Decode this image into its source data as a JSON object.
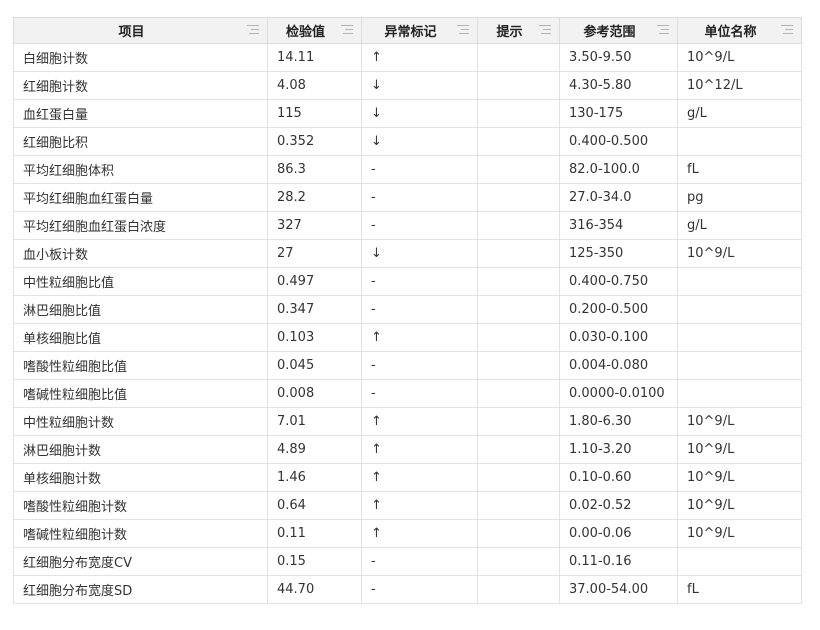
{
  "columns": [
    "项目",
    "检验值",
    "异常标记",
    "提示",
    "参考范围",
    "单位名称"
  ],
  "rows": [
    {
      "item": "白细胞计数",
      "value": "14.11",
      "flag": "↑",
      "hint": "",
      "range": "3.50-9.50",
      "unit": "10^9/L"
    },
    {
      "item": "红细胞计数",
      "value": "4.08",
      "flag": "↓",
      "hint": "",
      "range": "4.30-5.80",
      "unit": "10^12/L"
    },
    {
      "item": "血红蛋白量",
      "value": "115",
      "flag": "↓",
      "hint": "",
      "range": "130-175",
      "unit": "g/L"
    },
    {
      "item": "红细胞比积",
      "value": "0.352",
      "flag": "↓",
      "hint": "",
      "range": "0.400-0.500",
      "unit": ""
    },
    {
      "item": "平均红细胞体积",
      "value": "86.3",
      "flag": "-",
      "hint": "",
      "range": "82.0-100.0",
      "unit": "fL"
    },
    {
      "item": "平均红细胞血红蛋白量",
      "value": "28.2",
      "flag": "-",
      "hint": "",
      "range": "27.0-34.0",
      "unit": "pg"
    },
    {
      "item": "平均红细胞血红蛋白浓度",
      "value": "327",
      "flag": "-",
      "hint": "",
      "range": "316-354",
      "unit": "g/L"
    },
    {
      "item": "血小板计数",
      "value": "27",
      "flag": "↓",
      "hint": "",
      "range": "125-350",
      "unit": "10^9/L"
    },
    {
      "item": "中性粒细胞比值",
      "value": "0.497",
      "flag": "-",
      "hint": "",
      "range": "0.400-0.750",
      "unit": ""
    },
    {
      "item": "淋巴细胞比值",
      "value": "0.347",
      "flag": "-",
      "hint": "",
      "range": "0.200-0.500",
      "unit": ""
    },
    {
      "item": "单核细胞比值",
      "value": "0.103",
      "flag": "↑",
      "hint": "",
      "range": "0.030-0.100",
      "unit": ""
    },
    {
      "item": "嗜酸性粒细胞比值",
      "value": "0.045",
      "flag": "-",
      "hint": "",
      "range": "0.004-0.080",
      "unit": ""
    },
    {
      "item": "嗜碱性粒细胞比值",
      "value": "0.008",
      "flag": "-",
      "hint": "",
      "range": "0.0000-0.0100",
      "unit": ""
    },
    {
      "item": "中性粒细胞计数",
      "value": "7.01",
      "flag": "↑",
      "hint": "",
      "range": "1.80-6.30",
      "unit": "10^9/L"
    },
    {
      "item": "淋巴细胞计数",
      "value": "4.89",
      "flag": "↑",
      "hint": "",
      "range": "1.10-3.20",
      "unit": "10^9/L"
    },
    {
      "item": "单核细胞计数",
      "value": "1.46",
      "flag": "↑",
      "hint": "",
      "range": "0.10-0.60",
      "unit": "10^9/L"
    },
    {
      "item": "嗜酸性粒细胞计数",
      "value": "0.64",
      "flag": "↑",
      "hint": "",
      "range": "0.02-0.52",
      "unit": "10^9/L"
    },
    {
      "item": "嗜碱性粒细胞计数",
      "value": "0.11",
      "flag": "↑",
      "hint": "",
      "range": "0.00-0.06",
      "unit": "10^9/L"
    },
    {
      "item": "红细胞分布宽度CV",
      "value": "0.15",
      "flag": "-",
      "hint": "",
      "range": "0.11-0.16",
      "unit": ""
    },
    {
      "item": "红细胞分布宽度SD",
      "value": "44.70",
      "flag": "-",
      "hint": "",
      "range": "37.00-54.00",
      "unit": "fL"
    }
  ]
}
